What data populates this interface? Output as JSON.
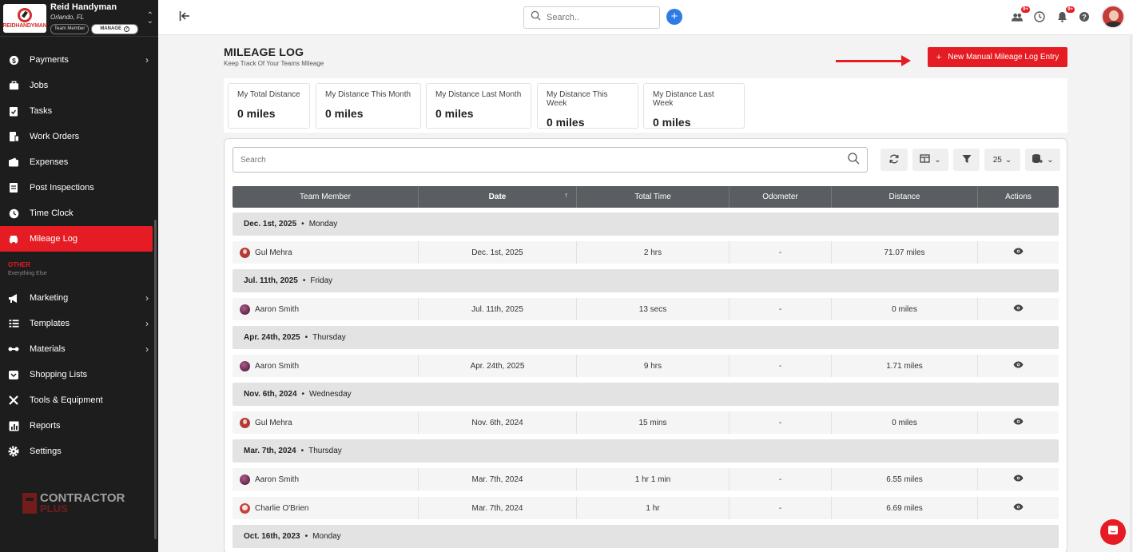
{
  "brand": {
    "name": "Reid Handyman",
    "location": "Orlando, FL",
    "role_chip": "Team Member",
    "manage_label": "MANAGE",
    "logo_wordmark": "REIDHANDYMAN"
  },
  "sidebar": {
    "items": [
      {
        "label": "Payments",
        "icon": "payments-icon",
        "chevron": true
      },
      {
        "label": "Jobs",
        "icon": "briefcase-icon"
      },
      {
        "label": "Tasks",
        "icon": "clipboard-check-icon"
      },
      {
        "label": "Work Orders",
        "icon": "work-orders-icon"
      },
      {
        "label": "Expenses",
        "icon": "expenses-icon"
      },
      {
        "label": "Post Inspections",
        "icon": "inspection-icon"
      },
      {
        "label": "Time Clock",
        "icon": "clock-icon"
      },
      {
        "label": "Mileage Log",
        "icon": "car-icon",
        "active": true
      }
    ],
    "other_title": "OTHER",
    "other_subtitle": "Everything Else",
    "other_items": [
      {
        "label": "Marketing",
        "icon": "megaphone-icon",
        "chevron": true
      },
      {
        "label": "Templates",
        "icon": "templates-icon",
        "chevron": true
      },
      {
        "label": "Materials",
        "icon": "materials-icon",
        "chevron": true
      },
      {
        "label": "Shopping Lists",
        "icon": "cart-icon"
      },
      {
        "label": "Tools & Equipment",
        "icon": "tools-icon"
      },
      {
        "label": "Reports",
        "icon": "chart-icon"
      },
      {
        "label": "Settings",
        "icon": "gear-icon"
      }
    ],
    "footer_logo_top": "CONTRACTOR",
    "footer_logo_bottom": "PLUS"
  },
  "topbar": {
    "search_placeholder": "Search..",
    "badges": {
      "team": "9+",
      "bell": "9+"
    }
  },
  "page": {
    "title": "MILEAGE LOG",
    "subtitle": "Keep Track Of Your Teams Mileage",
    "new_button": "New Manual Mileage Log Entry"
  },
  "stats": [
    {
      "title": "My Total Distance",
      "value": "0 miles"
    },
    {
      "title": "My Distance This Month",
      "value": "0 miles"
    },
    {
      "title": "My Distance Last Month",
      "value": "0 miles"
    },
    {
      "title": "My Distance This Week",
      "value": "0 miles"
    },
    {
      "title": "My Distance Last Week",
      "value": "0 miles"
    }
  ],
  "table": {
    "search_placeholder": "Search",
    "page_size": "25",
    "columns": [
      "Team Member",
      "Date",
      "Total Time",
      "Odometer",
      "Distance",
      "Actions"
    ],
    "sorted_column": "Date",
    "groups": [
      {
        "date": "Dec. 1st, 2025",
        "weekday": "Monday",
        "rows": [
          {
            "member": "Gul Mehra",
            "avatar": "r",
            "date": "Dec. 1st, 2025",
            "time": "2 hrs",
            "odometer": "-",
            "distance": "71.07 miles"
          }
        ]
      },
      {
        "date": "Jul. 11th, 2025",
        "weekday": "Friday",
        "rows": [
          {
            "member": "Aaron Smith",
            "avatar": "d",
            "date": "Jul. 11th, 2025",
            "time": "13 secs",
            "odometer": "-",
            "distance": "0 miles"
          }
        ]
      },
      {
        "date": "Apr. 24th, 2025",
        "weekday": "Thursday",
        "rows": [
          {
            "member": "Aaron Smith",
            "avatar": "d",
            "date": "Apr. 24th, 2025",
            "time": "9 hrs",
            "odometer": "-",
            "distance": "1.71 miles"
          }
        ]
      },
      {
        "date": "Nov. 6th, 2024",
        "weekday": "Wednesday",
        "rows": [
          {
            "member": "Gul Mehra",
            "avatar": "r",
            "date": "Nov. 6th, 2024",
            "time": "15 mins",
            "odometer": "-",
            "distance": "0 miles"
          }
        ]
      },
      {
        "date": "Mar. 7th, 2024",
        "weekday": "Thursday",
        "rows": [
          {
            "member": "Aaron Smith",
            "avatar": "d",
            "date": "Mar. 7th, 2024",
            "time": "1 hr 1 min",
            "odometer": "-",
            "distance": "6.55 miles"
          },
          {
            "member": "Charlie O'Brien",
            "avatar": "c",
            "date": "Mar. 7th, 2024",
            "time": "1 hr",
            "odometer": "-",
            "distance": "6.69 miles"
          }
        ]
      },
      {
        "date": "Oct. 16th, 2023",
        "weekday": "Monday",
        "rows": []
      }
    ]
  },
  "colors": {
    "accent": "#e51c23",
    "sidebar_bg": "#1d1d1d",
    "header_bg": "#5a5e63",
    "link_blue": "#2d7be5"
  }
}
